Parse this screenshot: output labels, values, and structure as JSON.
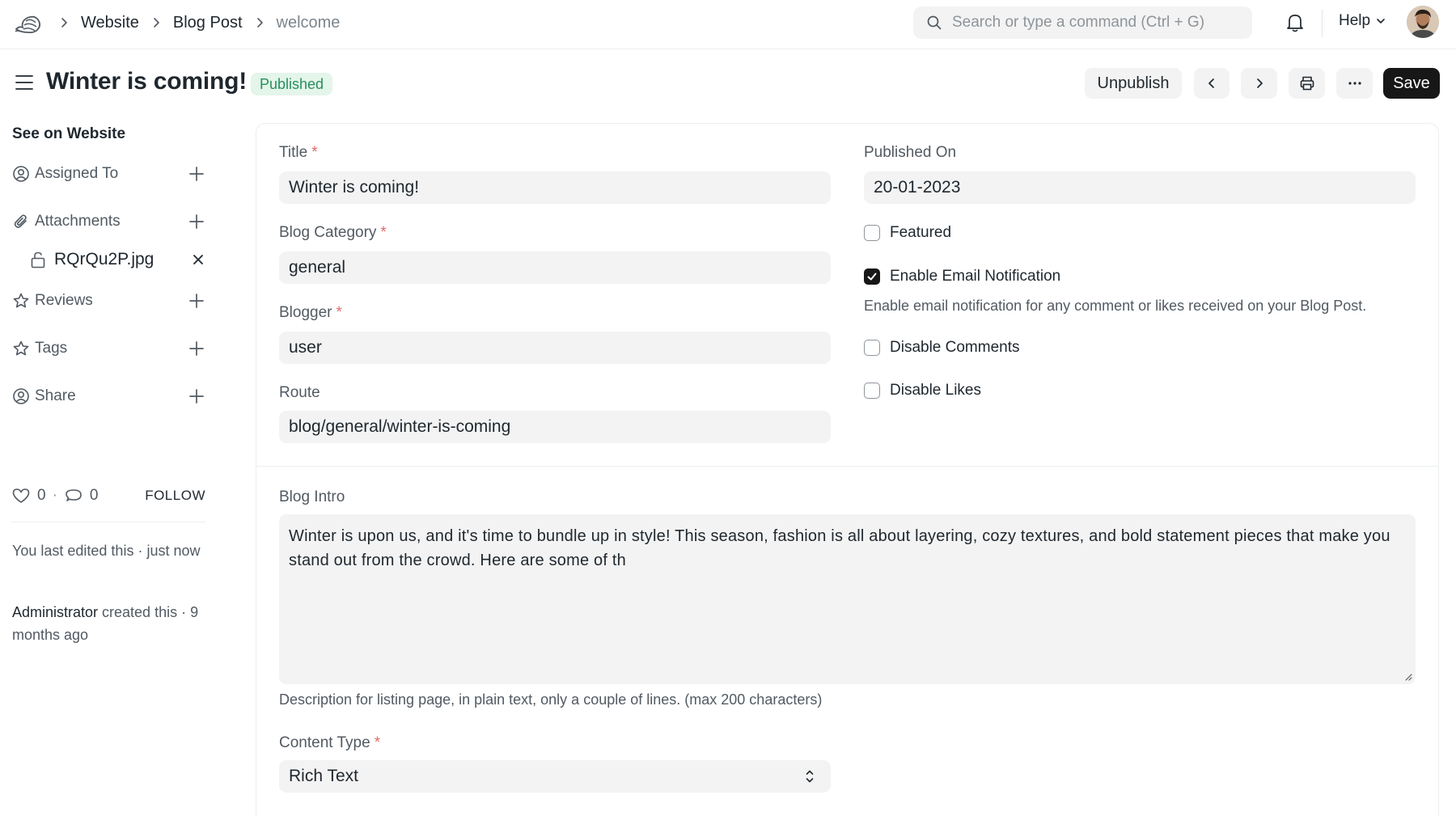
{
  "breadcrumb": {
    "items": [
      "Website",
      "Blog Post"
    ],
    "current": "welcome"
  },
  "search": {
    "placeholder": "Search or type a command (Ctrl + G)"
  },
  "nav": {
    "help_label": "Help"
  },
  "page": {
    "title": "Winter is coming!",
    "status": "Published",
    "status_color": "#278f5e"
  },
  "actions": {
    "unpublish_label": "Unpublish",
    "save_label": "Save"
  },
  "sidebar": {
    "see_on_website": "See on Website",
    "assigned_to": "Assigned To",
    "attachments": "Attachments",
    "attachment_file": "RQrQu2P.jpg",
    "reviews": "Reviews",
    "tags": "Tags",
    "share": "Share",
    "likes": "0",
    "comments": "0",
    "follow": "FOLLOW",
    "activity_1": "You last edited this · just now",
    "activity_2_user": "Administrator",
    "activity_2_text": " created this · 9 months ago"
  },
  "form": {
    "title_label": "Title",
    "title_value": "Winter is coming!",
    "blog_category_label": "Blog Category",
    "blog_category_value": "general",
    "blogger_label": "Blogger",
    "blogger_value": "user",
    "route_label": "Route",
    "route_value": "blog/general/winter-is-coming",
    "published_on_label": "Published On",
    "published_on_value": "20-01-2023",
    "featured_label": "Featured",
    "featured_checked": false,
    "email_notification_label": "Enable Email Notification",
    "email_notification_checked": true,
    "email_notification_help": "Enable email notification for any comment or likes received on your Blog Post.",
    "disable_comments_label": "Disable Comments",
    "disable_comments_checked": false,
    "disable_likes_label": "Disable Likes",
    "disable_likes_checked": false,
    "blog_intro_label": "Blog Intro",
    "blog_intro_value": "Winter is upon us, and it's time to bundle up in style! This season, fashion is all about layering, cozy textures, and bold statement pieces that make you stand out from the crowd. Here are some of th",
    "blog_intro_help": "Description for listing page, in plain text, only a couple of lines. (max 200 characters)",
    "content_type_label": "Content Type",
    "content_type_value": "Rich Text",
    "required_mark": "*"
  },
  "colors": {
    "primary_button": "#171717",
    "input_bg": "#f3f3f3",
    "required": "#e36b6b"
  }
}
